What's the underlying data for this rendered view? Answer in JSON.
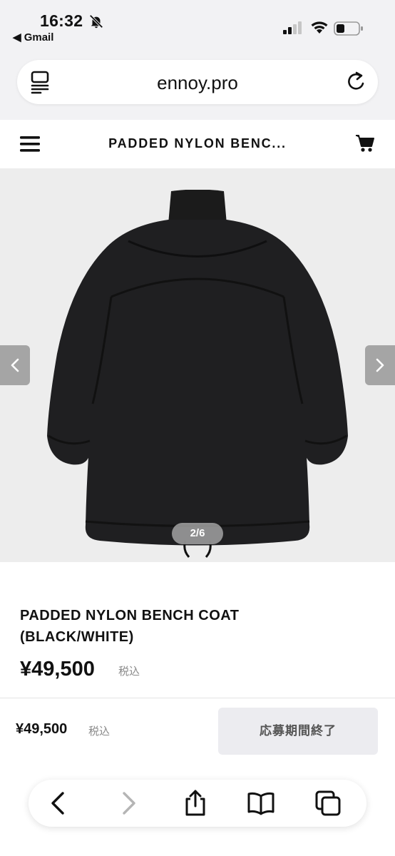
{
  "status_bar": {
    "time": "16:32",
    "back_app": "◀ Gmail"
  },
  "browser": {
    "domain": "ennoy.pro"
  },
  "site_header": {
    "title": "PADDED NYLON BENC..."
  },
  "gallery": {
    "counter": "2/6"
  },
  "product": {
    "name_line1": "PADDED NYLON BENCH COAT",
    "name_line2": "(BLACK/WHITE)",
    "price": "¥49,500",
    "tax_label": "税込"
  },
  "purchase_bar": {
    "price": "¥49,500",
    "tax_label": "税込",
    "button_label": "応募期間終了"
  },
  "colors": {
    "background": "#f2f2f4",
    "gallery_bg": "#ededed",
    "disabled_button": "#ececf0",
    "text": "#111111",
    "muted": "#888888"
  },
  "icons": {
    "reader": "reader-icon",
    "reload": "reload-icon",
    "menu": "hamburger-menu-icon",
    "cart": "cart-icon",
    "back": "chevron-left-icon",
    "forward": "chevron-right-icon",
    "share": "share-icon",
    "bookmarks": "book-icon",
    "tabs": "tabs-icon"
  }
}
